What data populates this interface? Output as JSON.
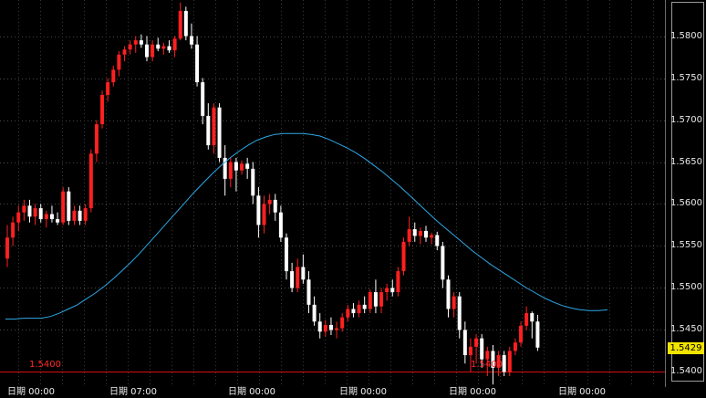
{
  "chart_data": {
    "type": "candlestick",
    "y_range": [
      1.5382,
      1.5843
    ],
    "price_ticks": [
      "1.5800",
      "1.5750",
      "1.5700",
      "1.5650",
      "1.5600",
      "1.5550",
      "1.5500",
      "1.5450",
      "1.5400"
    ],
    "last_price": "1.5429",
    "reference_line": {
      "value": 1.54,
      "label": "1.5400"
    },
    "time_labels": [
      "日期 00:00",
      "日期 07:00",
      "日期 00:00",
      "日期 00:00",
      "日期 00:00",
      "日期 00:00"
    ],
    "candles": [
      [
        1.5535,
        1.5575,
        1.5525,
        1.556
      ],
      [
        1.556,
        1.5585,
        1.555,
        1.5578
      ],
      [
        1.5578,
        1.5598,
        1.5568,
        1.559
      ],
      [
        1.559,
        1.5605,
        1.558,
        1.5598
      ],
      [
        1.5598,
        1.5605,
        1.5578,
        1.5585
      ],
      [
        1.5585,
        1.56,
        1.5575,
        1.5595
      ],
      [
        1.5595,
        1.56,
        1.5578,
        1.5582
      ],
      [
        1.5582,
        1.5592,
        1.5572,
        1.5588
      ],
      [
        1.5588,
        1.5598,
        1.5578,
        1.5582
      ],
      [
        1.5582,
        1.559,
        1.5575,
        1.5578
      ],
      [
        1.5578,
        1.562,
        1.5575,
        1.5615
      ],
      [
        1.5615,
        1.562,
        1.5575,
        1.558
      ],
      [
        1.558,
        1.5598,
        1.5575,
        1.5592
      ],
      [
        1.5592,
        1.5598,
        1.5575,
        1.558
      ],
      [
        1.558,
        1.56,
        1.5575,
        1.5595
      ],
      [
        1.5595,
        1.5665,
        1.559,
        1.566
      ],
      [
        1.566,
        1.57,
        1.565,
        1.5695
      ],
      [
        1.5695,
        1.5735,
        1.569,
        1.573
      ],
      [
        1.573,
        1.575,
        1.5722,
        1.5745
      ],
      [
        1.5745,
        1.5765,
        1.574,
        1.576
      ],
      [
        1.576,
        1.5782,
        1.5752,
        1.5778
      ],
      [
        1.5778,
        1.5788,
        1.577,
        1.5784
      ],
      [
        1.5784,
        1.5795,
        1.5778,
        1.579
      ],
      [
        1.579,
        1.58,
        1.578,
        1.5795
      ],
      [
        1.5795,
        1.5802,
        1.5786,
        1.579
      ],
      [
        1.579,
        1.58,
        1.577,
        1.5775
      ],
      [
        1.5775,
        1.5795,
        1.577,
        1.579
      ],
      [
        1.579,
        1.5798,
        1.5782,
        1.5785
      ],
      [
        1.5785,
        1.5792,
        1.5778,
        1.5788
      ],
      [
        1.5788,
        1.5795,
        1.578,
        1.5783
      ],
      [
        1.5783,
        1.58,
        1.5775,
        1.5797
      ],
      [
        1.5797,
        1.584,
        1.5795,
        1.583
      ],
      [
        1.583,
        1.5835,
        1.5795,
        1.58
      ],
      [
        1.58,
        1.5815,
        1.5785,
        1.579
      ],
      [
        1.579,
        1.58,
        1.574,
        1.5745
      ],
      [
        1.5745,
        1.575,
        1.5695,
        1.5705
      ],
      [
        1.5705,
        1.572,
        1.5665,
        1.567
      ],
      [
        1.567,
        1.572,
        1.566,
        1.5715
      ],
      [
        1.5715,
        1.572,
        1.565,
        1.5655
      ],
      [
        1.5655,
        1.567,
        1.561,
        1.563
      ],
      [
        1.563,
        1.5655,
        1.562,
        1.565
      ],
      [
        1.565,
        1.5655,
        1.5615,
        1.564
      ],
      [
        1.564,
        1.5652,
        1.5635,
        1.5648
      ],
      [
        1.5648,
        1.5655,
        1.563,
        1.5642
      ],
      [
        1.5642,
        1.565,
        1.56,
        1.561
      ],
      [
        1.561,
        1.562,
        1.556,
        1.5575
      ],
      [
        1.5575,
        1.561,
        1.5565,
        1.56
      ],
      [
        1.56,
        1.5612,
        1.5588,
        1.5605
      ],
      [
        1.5605,
        1.5612,
        1.558,
        1.559
      ],
      [
        1.559,
        1.5598,
        1.5555,
        1.556
      ],
      [
        1.556,
        1.5565,
        1.551,
        1.552
      ],
      [
        1.552,
        1.553,
        1.5495,
        1.55
      ],
      [
        1.55,
        1.5535,
        1.5495,
        1.5525
      ],
      [
        1.5525,
        1.554,
        1.5505,
        1.551
      ],
      [
        1.551,
        1.552,
        1.547,
        1.548
      ],
      [
        1.548,
        1.549,
        1.5455,
        1.546
      ],
      [
        1.546,
        1.547,
        1.544,
        1.5448
      ],
      [
        1.5448,
        1.5462,
        1.5442,
        1.5456
      ],
      [
        1.5456,
        1.5465,
        1.5444,
        1.545
      ],
      [
        1.545,
        1.546,
        1.544,
        1.5452
      ],
      [
        1.5452,
        1.547,
        1.5448,
        1.5465
      ],
      [
        1.5465,
        1.548,
        1.546,
        1.5475
      ],
      [
        1.5475,
        1.5482,
        1.5465,
        1.547
      ],
      [
        1.547,
        1.5485,
        1.5465,
        1.548
      ],
      [
        1.548,
        1.549,
        1.547,
        1.5475
      ],
      [
        1.5475,
        1.5498,
        1.547,
        1.5495
      ],
      [
        1.5495,
        1.551,
        1.547,
        1.5478
      ],
      [
        1.5478,
        1.55,
        1.547,
        1.5495
      ],
      [
        1.5495,
        1.5505,
        1.5485,
        1.55
      ],
      [
        1.55,
        1.551,
        1.549,
        1.5495
      ],
      [
        1.5495,
        1.5525,
        1.549,
        1.552
      ],
      [
        1.552,
        1.556,
        1.5515,
        1.5555
      ],
      [
        1.5555,
        1.5585,
        1.555,
        1.557
      ],
      [
        1.557,
        1.5578,
        1.5555,
        1.5562
      ],
      [
        1.5562,
        1.5572,
        1.5552,
        1.5568
      ],
      [
        1.5568,
        1.5574,
        1.5555,
        1.556
      ],
      [
        1.556,
        1.5566,
        1.5552,
        1.5563
      ],
      [
        1.5563,
        1.5567,
        1.5545,
        1.555
      ],
      [
        1.555,
        1.5555,
        1.55,
        1.551
      ],
      [
        1.551,
        1.5515,
        1.5465,
        1.5475
      ],
      [
        1.5475,
        1.5495,
        1.5465,
        1.549
      ],
      [
        1.549,
        1.5495,
        1.544,
        1.545
      ],
      [
        1.545,
        1.546,
        1.541,
        1.542
      ],
      [
        1.542,
        1.544,
        1.54,
        1.543
      ],
      [
        1.543,
        1.5445,
        1.541,
        1.544
      ],
      [
        1.544,
        1.5445,
        1.5405,
        1.5415
      ],
      [
        1.5415,
        1.543,
        1.5395,
        1.5425
      ],
      [
        1.5425,
        1.5432,
        1.5385,
        1.5405
      ],
      [
        1.5405,
        1.5425,
        1.5395,
        1.542
      ],
      [
        1.542,
        1.5425,
        1.5395,
        1.54
      ],
      [
        1.54,
        1.543,
        1.5395,
        1.5425
      ],
      [
        1.5425,
        1.544,
        1.542,
        1.5435
      ],
      [
        1.5435,
        1.546,
        1.543,
        1.5455
      ],
      [
        1.5455,
        1.5478,
        1.545,
        1.547
      ],
      [
        1.547,
        1.5472,
        1.544,
        1.546
      ],
      [
        1.546,
        1.5468,
        1.5425,
        1.5429
      ]
    ],
    "moving_average": [
      1.5463,
      1.5463,
      1.5464,
      1.5464,
      1.5464,
      1.5466,
      1.547,
      1.5475,
      1.548,
      1.5487,
      1.5494,
      1.5502,
      1.5511,
      1.5521,
      1.5531,
      1.5542,
      1.5554,
      1.5566,
      1.5578,
      1.559,
      1.5602,
      1.5614,
      1.5625,
      1.5636,
      1.5646,
      1.5655,
      1.5663,
      1.567,
      1.5676,
      1.568,
      1.5683,
      1.5684,
      1.5684,
      1.5684,
      1.5683,
      1.5681,
      1.5677,
      1.5672,
      1.5667,
      1.5661,
      1.5654,
      1.5646,
      1.5638,
      1.5629,
      1.562,
      1.561,
      1.56,
      1.559,
      1.558,
      1.5571,
      1.5562,
      1.5553,
      1.5544,
      1.5536,
      1.5528,
      1.5521,
      1.5514,
      1.5507,
      1.55,
      1.5494,
      1.5488,
      1.5483,
      1.5479,
      1.5476,
      1.5474,
      1.5473,
      1.5473,
      1.5474
    ]
  }
}
